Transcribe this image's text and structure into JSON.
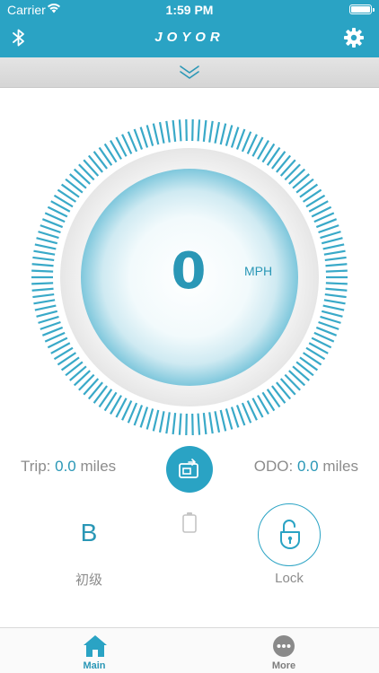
{
  "status_bar": {
    "carrier": "Carrier",
    "time": "1:59 PM"
  },
  "nav": {
    "logo": "JOYOR",
    "left_icon": "bluetooth-icon",
    "right_icon": "gear-icon"
  },
  "collapse": {
    "icon": "double-chevron-down-icon"
  },
  "gauge": {
    "speed": "0",
    "unit": "MPH"
  },
  "stats": {
    "trip_label": "Trip:",
    "trip_value": "0.0",
    "trip_unit": "miles",
    "odo_label": "ODO:",
    "odo_value": "0.0",
    "odo_unit": "miles"
  },
  "controls": {
    "mode": "B",
    "mode_label": "初级",
    "lock_label": "Lock",
    "center_icon": "switch-screen-icon",
    "battery_icon": "battery-icon",
    "lock_icon": "padlock-open-icon"
  },
  "tabs": [
    {
      "label": "Main",
      "icon": "home-icon",
      "active": true
    },
    {
      "label": "More",
      "icon": "more-icon",
      "active": false
    }
  ],
  "colors": {
    "accent": "#2aa3c4",
    "text_accent": "#2a97b6",
    "muted": "#8c8c8c"
  }
}
